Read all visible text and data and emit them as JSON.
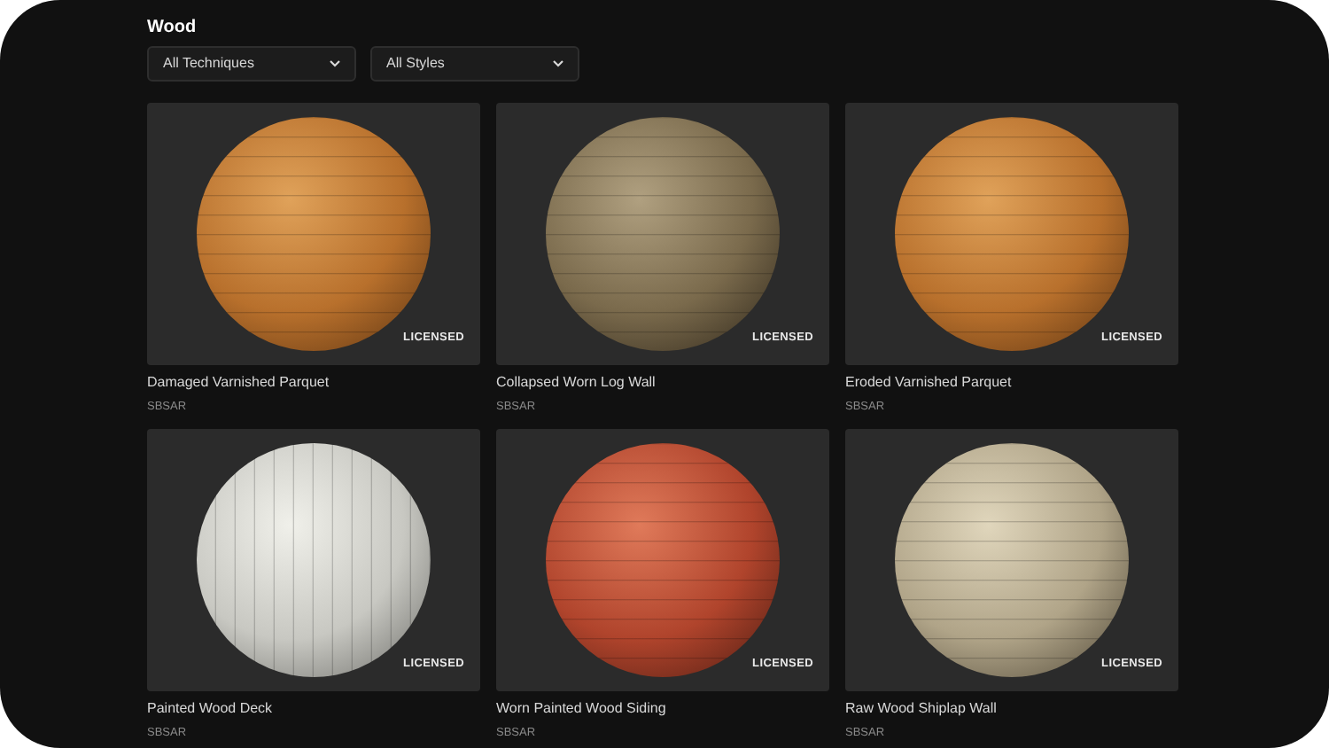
{
  "heading": "Wood",
  "filters": [
    {
      "label": "All Techniques"
    },
    {
      "label": "All Styles"
    }
  ],
  "materials": [
    {
      "name": "Damaged Varnished Parquet",
      "format": "SBSAR",
      "badge": "LICENSED"
    },
    {
      "name": "Collapsed Worn Log Wall",
      "format": "SBSAR",
      "badge": "LICENSED"
    },
    {
      "name": "Eroded Varnished Parquet",
      "format": "SBSAR",
      "badge": "LICENSED"
    },
    {
      "name": "Painted Wood Deck",
      "format": "SBSAR",
      "badge": "LICENSED"
    },
    {
      "name": "Worn Painted Wood Siding",
      "format": "SBSAR",
      "badge": "LICENSED"
    },
    {
      "name": "Raw Wood Shiplap Wall",
      "format": "SBSAR",
      "badge": "LICENSED"
    }
  ]
}
